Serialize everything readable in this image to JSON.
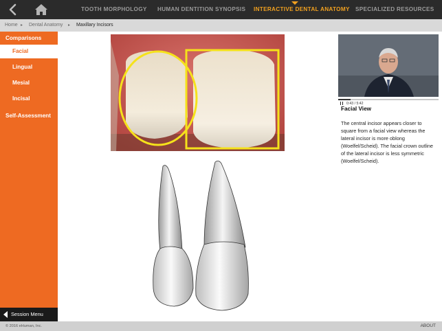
{
  "nav": {
    "items": [
      "TOOTH MORPHOLOGY",
      "HUMAN DENTITION SYNOPSIS",
      "INTERACTIVE DENTAL ANATOMY",
      "SPECIALIZED RESOURCES"
    ],
    "active_index": 2,
    "accent_color": "#f0a020"
  },
  "breadcrumb": {
    "home": "Home",
    "section": "Dental Anatomy",
    "current": "Maxillary Incisors"
  },
  "sidebar": {
    "header": "Comparisons",
    "items": [
      "Facial",
      "Lingual",
      "Mesial",
      "Incisal"
    ],
    "active_index": 0,
    "self_assessment": "Self-Assessment",
    "session_menu": "Session Menu",
    "color": "#ee6a22"
  },
  "video": {
    "current_time": "0:43",
    "separator": "/",
    "duration": "5:42",
    "progress": 0.126
  },
  "info": {
    "title": "Facial View",
    "body": "The central incisor appears closer to square from a facial view whereas the lateral incisor is more oblong (Woelfel/Scheid). The facial crown outline of the lateral incisor is less symmetric (Woelfel/Scheid)."
  },
  "footer": {
    "copyright": "© 2016 eHuman, Inc.",
    "about": "ABOUT"
  },
  "icons": {
    "back": "chevron-left-icon",
    "home": "home-icon",
    "session": "triangle-left-icon",
    "pause": "pause-icon"
  }
}
